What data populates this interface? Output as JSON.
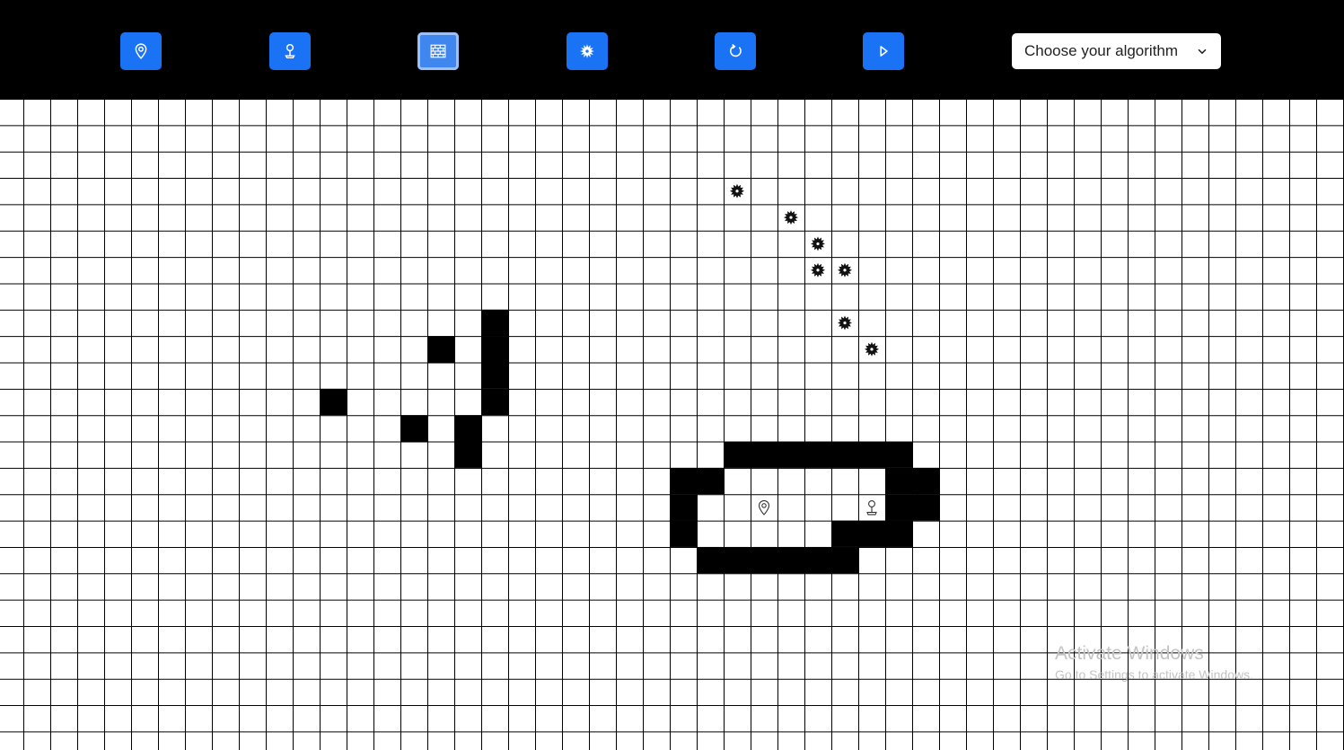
{
  "toolbar": {
    "buttons": [
      {
        "name": "start-node-button",
        "icon": "map-pin-icon",
        "active": false
      },
      {
        "name": "target-node-button",
        "icon": "pushpin-icon",
        "active": false
      },
      {
        "name": "wall-tool-button",
        "icon": "brick-wall-icon",
        "active": true
      },
      {
        "name": "weight-tool-button",
        "icon": "gear-cog-icon",
        "active": false
      },
      {
        "name": "reset-button",
        "icon": "refresh-icon",
        "active": false
      },
      {
        "name": "visualize-button",
        "icon": "play-icon",
        "active": false
      }
    ],
    "algorithm_select": {
      "value": "Choose your algorithm"
    }
  },
  "colors": {
    "toolbar_bg": "#000000",
    "button_bg": "#1a73f5",
    "wall": "#000000",
    "grid_line": "#000000"
  },
  "grid": {
    "start_node": {
      "row": 15,
      "col": 28
    },
    "target_node": {
      "row": 15,
      "col": 32
    },
    "walls": [
      [
        8,
        18
      ],
      [
        9,
        16
      ],
      [
        9,
        18
      ],
      [
        10,
        18
      ],
      [
        11,
        12
      ],
      [
        11,
        18
      ],
      [
        12,
        15
      ],
      [
        12,
        17
      ],
      [
        13,
        17
      ],
      [
        13,
        27
      ],
      [
        13,
        28
      ],
      [
        13,
        29
      ],
      [
        13,
        30
      ],
      [
        13,
        31
      ],
      [
        13,
        32
      ],
      [
        13,
        33
      ],
      [
        14,
        25
      ],
      [
        14,
        26
      ],
      [
        14,
        33
      ],
      [
        14,
        34
      ],
      [
        15,
        25
      ],
      [
        15,
        33
      ],
      [
        15,
        34
      ],
      [
        16,
        25
      ],
      [
        16,
        31
      ],
      [
        16,
        32
      ],
      [
        16,
        33
      ],
      [
        17,
        26
      ],
      [
        17,
        27
      ],
      [
        17,
        28
      ],
      [
        17,
        29
      ],
      [
        17,
        30
      ],
      [
        17,
        31
      ]
    ],
    "weights": [
      [
        3,
        27
      ],
      [
        4,
        29
      ],
      [
        5,
        30
      ],
      [
        6,
        30
      ],
      [
        6,
        31
      ],
      [
        8,
        31
      ],
      [
        9,
        32
      ]
    ]
  },
  "watermark": {
    "title": "Activate Windows",
    "subtitle": "Go to Settings to activate Windows."
  }
}
